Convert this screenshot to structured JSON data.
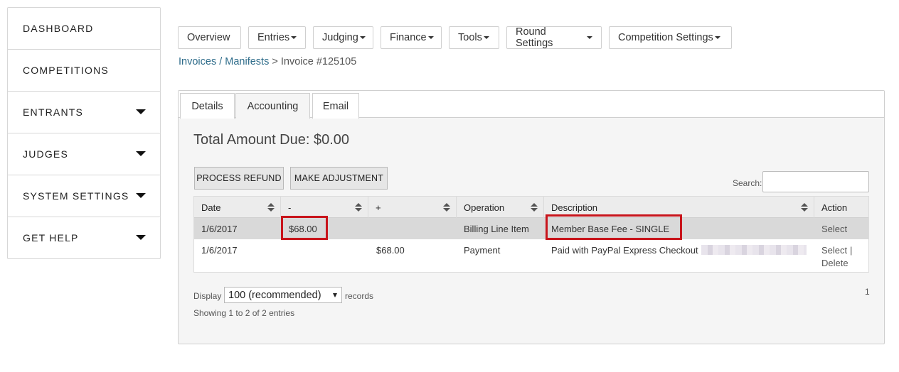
{
  "sidebar": {
    "items": [
      {
        "label": "DASHBOARD",
        "has_caret": false
      },
      {
        "label": "COMPETITIONS",
        "has_caret": false
      },
      {
        "label": "ENTRANTS",
        "has_caret": true
      },
      {
        "label": "JUDGES",
        "has_caret": true
      },
      {
        "label": "SYSTEM SETTINGS",
        "has_caret": true
      },
      {
        "label": "GET HELP",
        "has_caret": true
      }
    ]
  },
  "topnav": {
    "overview": "Overview",
    "entries": "Entries",
    "judging": "Judging",
    "finance": "Finance",
    "tools": "Tools",
    "round_settings": "Round Settings",
    "competition_settings": "Competition Settings"
  },
  "breadcrumb": {
    "link": "Invoices / Manifests",
    "separator": ">",
    "current": "Invoice #125105"
  },
  "tabs": {
    "details": "Details",
    "accounting": "Accounting",
    "email": "Email",
    "active": "Accounting"
  },
  "accounting": {
    "total_label": "Total Amount Due: $0.00",
    "process_refund": "PROCESS REFUND",
    "make_adjustment": "MAKE ADJUSTMENT",
    "search_label": "Search:",
    "search_value": ""
  },
  "table": {
    "headers": [
      "Date",
      "-",
      "+",
      "Operation",
      "Description",
      "Action"
    ],
    "rows": [
      {
        "date": "1/6/2017",
        "minus": "$68.00",
        "plus": "",
        "operation": "Billing Line Item",
        "description": "Member Base Fee - SINGLE",
        "action_select": "Select",
        "highlighted": true
      },
      {
        "date": "1/6/2017",
        "minus": "",
        "plus": "$68.00",
        "operation": "Payment",
        "description": "Paid with PayPal Express Checkout",
        "action_select": "Select",
        "action_sep": "|",
        "action_delete": "Delete",
        "highlighted": false
      }
    ]
  },
  "pagination": {
    "display_label": "Display",
    "display_value": "100 (recommended)",
    "records_label": "records",
    "showing": "Showing 1 to 2 of 2 entries",
    "page": "1"
  },
  "colors": {
    "link": "#2e6c8a",
    "highlight_border": "#c8141b",
    "selected_row": "#d9d9d9"
  }
}
